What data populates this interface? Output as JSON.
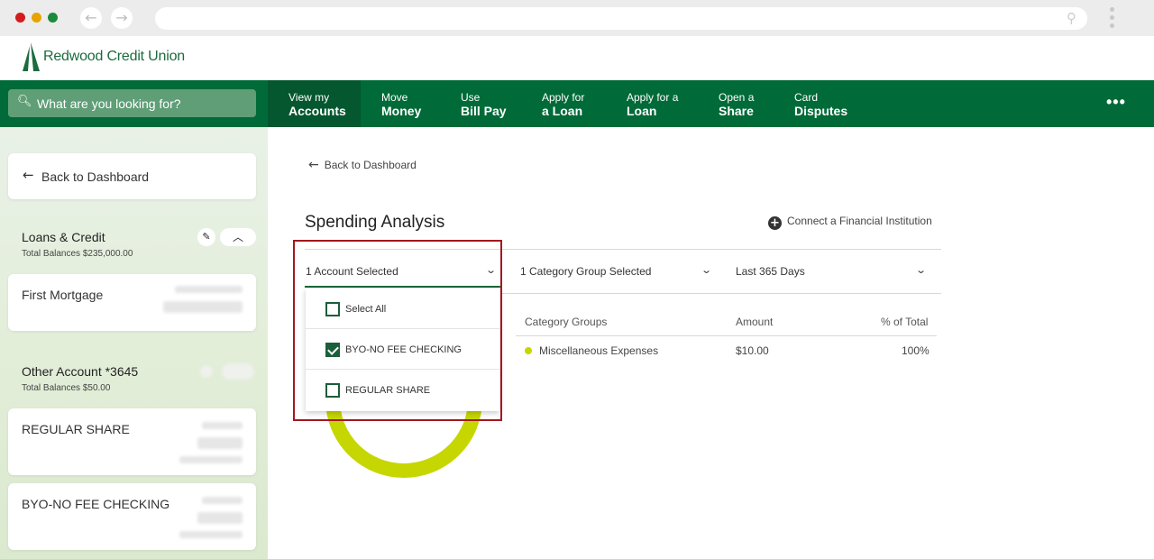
{
  "browser": {
    "dots": [
      "#d21d1d",
      "#e6a400",
      "#1b8a3c"
    ],
    "back_icon": "←",
    "forward_icon": "→"
  },
  "brand": {
    "name": "Redwood Credit Union",
    "color": "#006a38"
  },
  "search": {
    "placeholder": "What are you looking for?"
  },
  "nav": [
    {
      "l1": "View my",
      "l2": "Accounts"
    },
    {
      "l1": "Move",
      "l2": "Money"
    },
    {
      "l1": "Use",
      "l2": "Bill Pay"
    },
    {
      "l1": "Apply for",
      "l2": "a Loan"
    },
    {
      "l1": "Apply for a",
      "l2": "Loan"
    },
    {
      "l1": "Open a",
      "l2": "Share"
    },
    {
      "l1": "Card",
      "l2": "Disputes"
    }
  ],
  "sidebar": {
    "back_label": "Back to Dashboard",
    "groups": [
      {
        "title": "Loans & Credit",
        "subtitle": "Total Balances $235,000.00",
        "accounts": [
          "First Mortgage"
        ]
      },
      {
        "title": "Other Account *3645",
        "subtitle": "Total Balances $50.00",
        "accounts": [
          "REGULAR SHARE",
          "BYO-NO FEE CHECKING"
        ]
      }
    ]
  },
  "main": {
    "back_label": "Back to Dashboard",
    "title": "Spending Analysis",
    "connect_label": "Connect a Financial Institution",
    "filters": {
      "account": "1 Account Selected",
      "category": "1 Category Group Selected",
      "range": "Last 365 Days"
    },
    "dropdown": [
      {
        "label": "Select All",
        "checked": false
      },
      {
        "label": "BYO-NO FEE CHECKING",
        "checked": true
      },
      {
        "label": "REGULAR SHARE",
        "checked": false
      }
    ],
    "table": {
      "headers": [
        "Category Groups",
        "Amount",
        "% of Total"
      ],
      "rows": [
        {
          "category": "Miscellaneous Expenses",
          "amount": "$10.00",
          "pct": "100%",
          "color": "#c6d600"
        }
      ]
    }
  }
}
